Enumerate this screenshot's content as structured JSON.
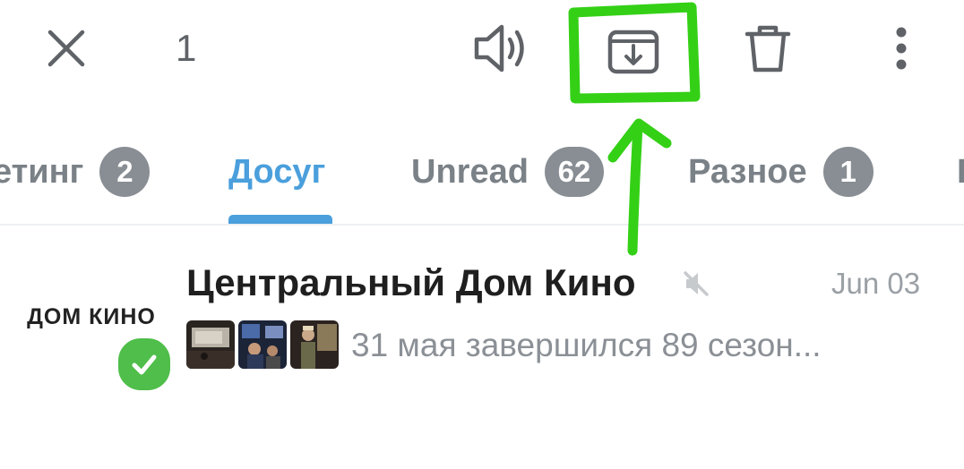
{
  "topbar": {
    "selected_count": "1",
    "icons": [
      "close-icon",
      "unmute-speaker-icon",
      "archive-icon",
      "trash-icon",
      "more-vertical-icon"
    ]
  },
  "tabs": [
    {
      "label": "етинг",
      "badge": "2"
    },
    {
      "label": "Досуг",
      "badge": ""
    },
    {
      "label": "Unread",
      "badge": "62"
    },
    {
      "label": "Разное",
      "badge": "1"
    },
    {
      "label": "I",
      "badge": ""
    }
  ],
  "chat": {
    "title": "Центральный Дом Кино",
    "date": "Jun 03",
    "avatar_text": "ДОМ КИНО",
    "preview": "31 мая завершился 89 сезон..."
  },
  "colors": {
    "accent": "#4a9fdc",
    "annotation": "#34d016",
    "badge": "#888e93",
    "verified": "#4fbe4a"
  }
}
